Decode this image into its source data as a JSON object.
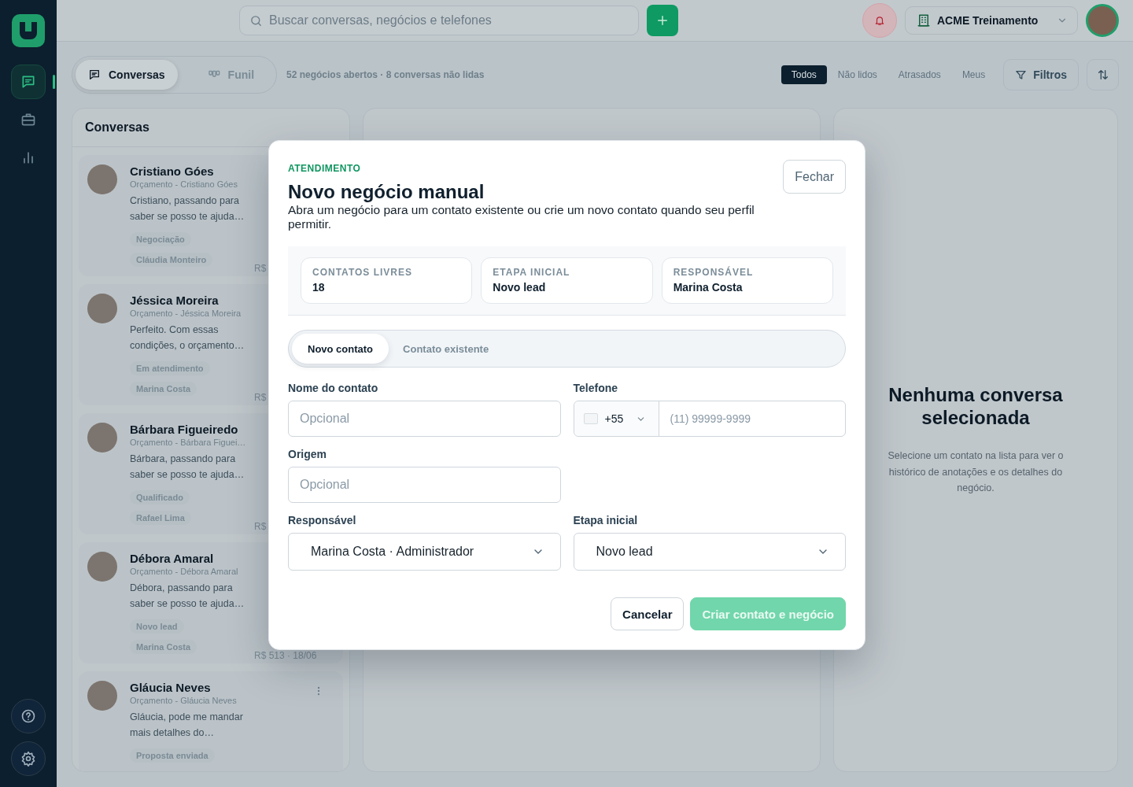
{
  "sidebar": {
    "nav": [
      {
        "selected": true
      },
      {
        "selected": false
      },
      {
        "selected": false
      }
    ]
  },
  "topbar": {
    "search": {
      "placeholder": "Buscar conversas, negócios e telefones"
    },
    "workspace": "ACME Treinamento"
  },
  "view_tabs": [
    {
      "label": "Conversas",
      "selected": true
    },
    {
      "label": "Funil",
      "selected": false
    }
  ],
  "summary": "52 negócios abertos · 8 conversas não lidas",
  "filters": [
    {
      "label": "Todos",
      "selected": true
    },
    {
      "label": "Não lidos",
      "selected": false
    },
    {
      "label": "Atrasados",
      "selected": false
    },
    {
      "label": "Meus",
      "selected": false
    }
  ],
  "filters_button": "Filtros",
  "conversations": {
    "title": "Conversas",
    "items": [
      {
        "name": "Cristiano Góes",
        "subtitle": "Orçamento - Cristiano Góes",
        "preview": "Cristiano, passando para saber se posso te ajuda…",
        "stage": "Negociação",
        "owner": "Cláudia Monteiro",
        "value": "R$"
      },
      {
        "name": "Jéssica Moreira",
        "subtitle": "Orçamento - Jéssica Moreira",
        "preview": "Perfeito. Com essas condições, o orçamento…",
        "stage": "Em atendimento",
        "owner": "Marina Costa",
        "value": "R$"
      },
      {
        "name": "Bárbara Figueiredo",
        "subtitle": "Orçamento - Bárbara Figuei…",
        "preview": "Bárbara, passando para saber se posso te ajuda…",
        "stage": "Qualificado",
        "owner": "Rafael Lima",
        "value": "R$"
      },
      {
        "name": "Débora Amaral",
        "subtitle": "Orçamento - Débora Amaral",
        "preview": "Débora, passando para saber se posso te ajuda…",
        "stage": "Novo lead",
        "owner": "Marina Costa",
        "value": "R$ 513 · 18/06"
      },
      {
        "name": "Gláucia Neves",
        "subtitle": "Orçamento - Gláucia Neves",
        "preview": "Gláucia, pode me mandar mais detalhes do…",
        "stage": "Proposta enviada",
        "menu": true
      }
    ]
  },
  "empty_state": {
    "title": "Nenhuma conversa selecionada",
    "text": "Selecione um contato na lista para ver o histórico de anotações e os detalhes do negócio."
  },
  "modal": {
    "eyebrow": "ATENDIMENTO",
    "title": "Novo negócio manual",
    "description": "Abra um negócio para um contato existente ou crie um novo contato quando seu perfil permitir.",
    "close": "Fechar",
    "stats": [
      {
        "label": "CONTATOS LIVRES",
        "value": "18"
      },
      {
        "label": "ETAPA INICIAL",
        "value": "Novo lead"
      },
      {
        "label": "RESPONSÁVEL",
        "value": "Marina Costa"
      }
    ],
    "modes": [
      {
        "label": "Novo contato",
        "selected": true
      },
      {
        "label": "Contato existente",
        "selected": false
      }
    ],
    "rows": [
      [
        {
          "kind": "text",
          "label": "Nome do contato",
          "placeholder": "Opcional"
        },
        {
          "kind": "phone",
          "label": "Telefone",
          "code": "+55",
          "placeholder": "(11) 99999-9999"
        }
      ],
      [
        {
          "kind": "text",
          "label": "Origem",
          "placeholder": "Opcional"
        }
      ],
      [
        {
          "kind": "select",
          "label": "Responsável",
          "value": "Marina Costa · Administrador"
        },
        {
          "kind": "select",
          "label": "Etapa inicial",
          "value": "Novo lead"
        }
      ]
    ],
    "cancel": "Cancelar",
    "submit": {
      "label": "Criar contato e negócio",
      "disabled": true
    }
  }
}
